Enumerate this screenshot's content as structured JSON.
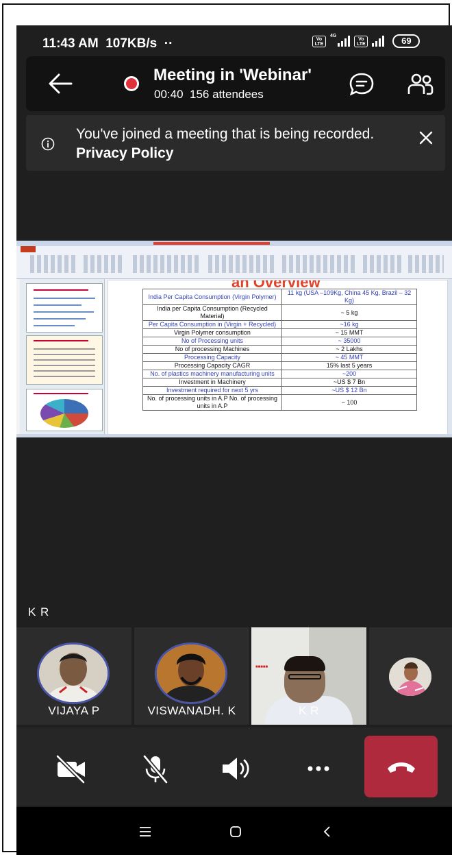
{
  "status_bar": {
    "time": "11:43 AM",
    "speed": "107KB/s",
    "dots": "··",
    "network": "4G",
    "volte_label": "Vo LTE",
    "battery": "69"
  },
  "header": {
    "back_icon": "arrow-left-icon",
    "recording_indicator": "red-dot",
    "title": "Meeting in 'Webinar'",
    "elapsed": "00:40",
    "attendees": "156 attendees",
    "chat_icon": "chat-bubble-icon",
    "people_icon": "people-icon"
  },
  "banner": {
    "text": "You've joined a meeting that is being recorded.",
    "link": "Privacy Policy",
    "info_icon": "info-icon",
    "close_icon": "close-icon"
  },
  "shared_slide": {
    "heading": "an Overview",
    "rows": [
      {
        "label": "India Per Capita Consumption (Virgin Polymer)",
        "value": "11 kg (USA –109Kg, China 45 Kg, Brazil – 32 Kg)",
        "color": "blue"
      },
      {
        "label": "India per Capita Consumption (Recycled Material)",
        "value": "~ 5 kg",
        "color": "black"
      },
      {
        "label": "Per Capita Consumption in (Virgin + Recycled)",
        "value": "~16 kg",
        "color": "blue"
      },
      {
        "label": "Virgin Polymer consumption",
        "value": "~ 15 MMT",
        "color": "black"
      },
      {
        "label": "No of Processing units",
        "value": "~ 35000",
        "color": "blue"
      },
      {
        "label": "No of processing Machines",
        "value": "~ 2 Lakhs",
        "color": "black"
      },
      {
        "label": "Processing Capacity",
        "value": "~ 45 MMT",
        "color": "blue"
      },
      {
        "label": "Processing Capacity CAGR",
        "value": "15% last 5 years",
        "color": "black"
      },
      {
        "label": "No. of plastics machinery manufacturing units",
        "value": "~200",
        "color": "blue"
      },
      {
        "label": "Investment in Machinery",
        "value": "~US $ 7 Bn",
        "color": "black"
      },
      {
        "label": "Investment required for next 5 yrs",
        "value": "~US $ 12 Bn",
        "color": "blue"
      },
      {
        "label": "No. of processing units in A.P No. of processing units in A.P",
        "value": "~ 100",
        "color": "black"
      }
    ]
  },
  "speaker_label": "K R",
  "participants": [
    {
      "name": "VIJAYA P"
    },
    {
      "name": "VISWANADH. K"
    },
    {
      "name": "K R"
    },
    {
      "name": ""
    }
  ],
  "controls": {
    "camera_icon": "camera-off-icon",
    "mic_icon": "mic-off-icon",
    "speaker_icon": "speaker-icon",
    "more_icon": "more-icon",
    "hangup_icon": "hang-up-icon",
    "hangup_color": "#b02a3e"
  },
  "navbar": {
    "menu_icon": "menu-icon",
    "home_icon": "home-icon",
    "back_icon": "back-chevron-icon"
  }
}
